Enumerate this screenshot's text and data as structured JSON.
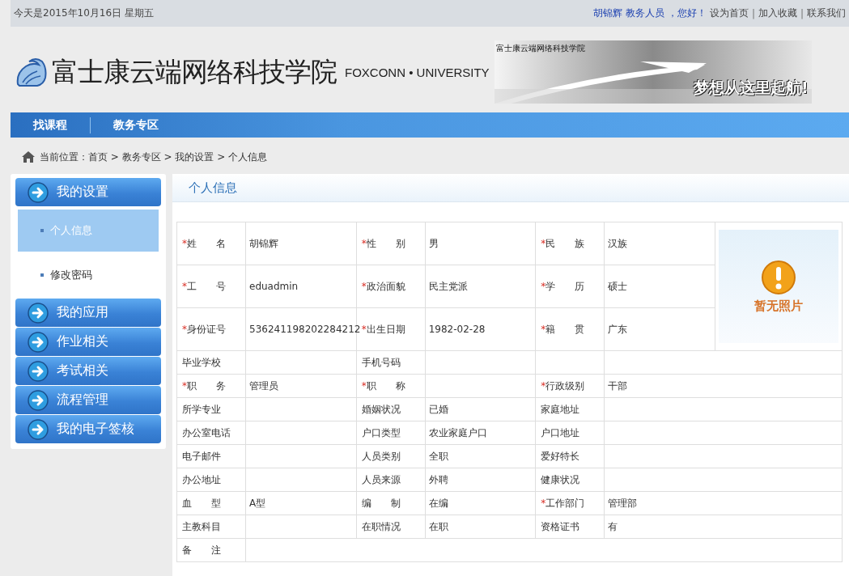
{
  "top_bar": {
    "date": "今天是2015年10月16日 星期五",
    "user_greeting": "胡锦辉 教务人员 ，您好！",
    "links": [
      "设为首页",
      "加入收藏",
      "联系我们"
    ],
    "separator": "|"
  },
  "header": {
    "title": "富士康云端网络科技学院",
    "subtitle": "FOXCONN • UNIVERSITY",
    "banner": {
      "caption": "富士康云端网络科技学院",
      "slogan": "梦想从这里起航!"
    }
  },
  "nav": [
    {
      "label": "找课程",
      "selected": false
    },
    {
      "label": "教务专区",
      "selected": false
    }
  ],
  "breadcrumb": "当前位置：首页 > 教务专区 > 我的设置 > 个人信息",
  "sidebar": [
    {
      "label": "我的设置",
      "children": [
        {
          "label": "个人信息",
          "selected": true
        },
        {
          "label": "修改密码",
          "selected": false
        }
      ]
    },
    {
      "label": "我的应用"
    },
    {
      "label": "作业相关"
    },
    {
      "label": "考试相关"
    },
    {
      "label": "流程管理"
    },
    {
      "label": "我的电子签核"
    }
  ],
  "panel": {
    "title": "个人信息",
    "photo_text": "暂无照片",
    "required_mark": "*",
    "rows": [
      {
        "kind": "fields",
        "cells": [
          {
            "label": "姓　　名",
            "required": true,
            "value": "胡锦辉"
          },
          {
            "label": "性　　别",
            "required": true,
            "value": "男"
          },
          {
            "label": "民　　族",
            "required": true,
            "value": "汉族"
          }
        ]
      },
      {
        "kind": "fields",
        "cells": [
          {
            "label": "工　　号",
            "required": true,
            "value": "eduadmin"
          },
          {
            "label": "政治面貌",
            "required": true,
            "value": "民主党派"
          },
          {
            "label": "学　　历",
            "required": true,
            "value": "硕士"
          }
        ]
      },
      {
        "kind": "fields",
        "cells": [
          {
            "label": "身份证号",
            "required": true,
            "value": "536241198202284212"
          },
          {
            "label": "出生日期",
            "required": true,
            "value": "1982-02-28"
          },
          {
            "label": "籍　　贯",
            "required": true,
            "value": "广东"
          }
        ]
      },
      {
        "kind": "fields",
        "cells": [
          {
            "label": "毕业学校",
            "required": false
          },
          {
            "label": "手机号码",
            "required": false
          }
        ]
      },
      {
        "kind": "fields",
        "cells": [
          {
            "label": "职　　务",
            "required": true,
            "value": "管理员"
          },
          {
            "label": "职　　称",
            "required": true
          },
          {
            "label": "行政级别",
            "required": true,
            "value": "干部"
          }
        ]
      },
      {
        "kind": "fields",
        "cells": [
          {
            "label": "所学专业",
            "required": false
          },
          {
            "label": "婚姻状况",
            "required": false,
            "value": "已婚"
          },
          {
            "label": "家庭地址",
            "required": false
          }
        ]
      },
      {
        "kind": "fields",
        "cells": [
          {
            "label": "办公室电话",
            "required": false
          },
          {
            "label": "户口类型",
            "required": false,
            "value": "农业家庭户口"
          },
          {
            "label": "户口地址",
            "required": false
          }
        ]
      },
      {
        "kind": "fields",
        "cells": [
          {
            "label": "电子邮件",
            "required": false
          },
          {
            "label": "人员类别",
            "required": false,
            "value": "全职"
          },
          {
            "label": "爱好特长",
            "required": false
          }
        ]
      },
      {
        "kind": "fields",
        "cells": [
          {
            "label": "办公地址",
            "required": false
          },
          {
            "label": "人员来源",
            "required": false,
            "value": "外聘"
          },
          {
            "label": "健康状况",
            "required": false
          }
        ]
      },
      {
        "kind": "fields",
        "cells": [
          {
            "label": "血　　型",
            "required": false,
            "value": "A型"
          },
          {
            "label": "编　　制",
            "required": false,
            "value": "在编"
          },
          {
            "label": "工作部门",
            "required": true,
            "value": "管理部"
          }
        ]
      },
      {
        "kind": "fields",
        "cells": [
          {
            "label": "主教科目",
            "required": false
          },
          {
            "label": "在职情况",
            "required": false,
            "value": "在职"
          },
          {
            "label": "资格证书",
            "required": false,
            "value": "有"
          }
        ]
      },
      {
        "kind": "note",
        "cells": [
          {
            "label": "备　　注",
            "required": false
          }
        ]
      }
    ]
  }
}
